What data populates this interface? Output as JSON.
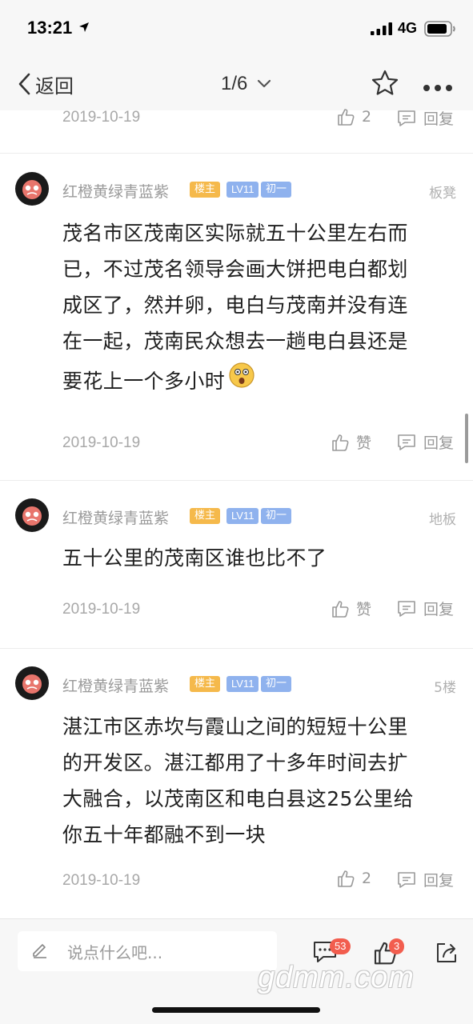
{
  "status_bar": {
    "time": "13:21",
    "network": "4G"
  },
  "nav": {
    "back_label": "返回",
    "page_indicator": "1/6"
  },
  "previous_post_footer": {
    "date": "2019-10-19",
    "like_count": "2",
    "reply_label": "回复"
  },
  "posts": [
    {
      "username": "红橙黄绿青蓝紫",
      "badge_owner": "楼主",
      "badge_level": "LV11",
      "badge_title": "初一",
      "floor": "板凳",
      "content_lines": [
        "茂名市区茂南区实际就五十公里左右而",
        "已，不过茂名领导会画大饼把电白都划",
        "成区了，然并卵，电白与茂南并没有连",
        "在一起，茂南民众想去一趟电白县还是",
        "要花上一个多小时"
      ],
      "date": "2019-10-19",
      "like_label": "赞",
      "reply_label": "回复"
    },
    {
      "username": "红橙黄绿青蓝紫",
      "badge_owner": "楼主",
      "badge_level": "LV11",
      "badge_title": "初一",
      "floor": "地板",
      "content_lines": [
        "五十公里的茂南区谁也比不了"
      ],
      "date": "2019-10-19",
      "like_label": "赞",
      "reply_label": "回复"
    },
    {
      "username": "红橙黄绿青蓝紫",
      "badge_owner": "楼主",
      "badge_level": "LV11",
      "badge_title": "初一",
      "floor": "5楼",
      "content_lines": [
        "湛江市区赤坎与霞山之间的短短十公里",
        "的开发区。湛江都用了十多年时间去扩",
        "大融合，以茂南区和电白县这25公里给",
        "你五十年都融不到一块"
      ],
      "date": "2019-10-19",
      "like_label": "2",
      "reply_label": "回复"
    }
  ],
  "bottom_bar": {
    "input_placeholder": "说点什么吧...",
    "comment_count": "53",
    "like_count": "3",
    "watermark": "gdmm.com"
  },
  "colors": {
    "owner_badge": "#f5b94b",
    "level_badge": "#8fb2ee",
    "count_badge": "#f25d4e"
  }
}
